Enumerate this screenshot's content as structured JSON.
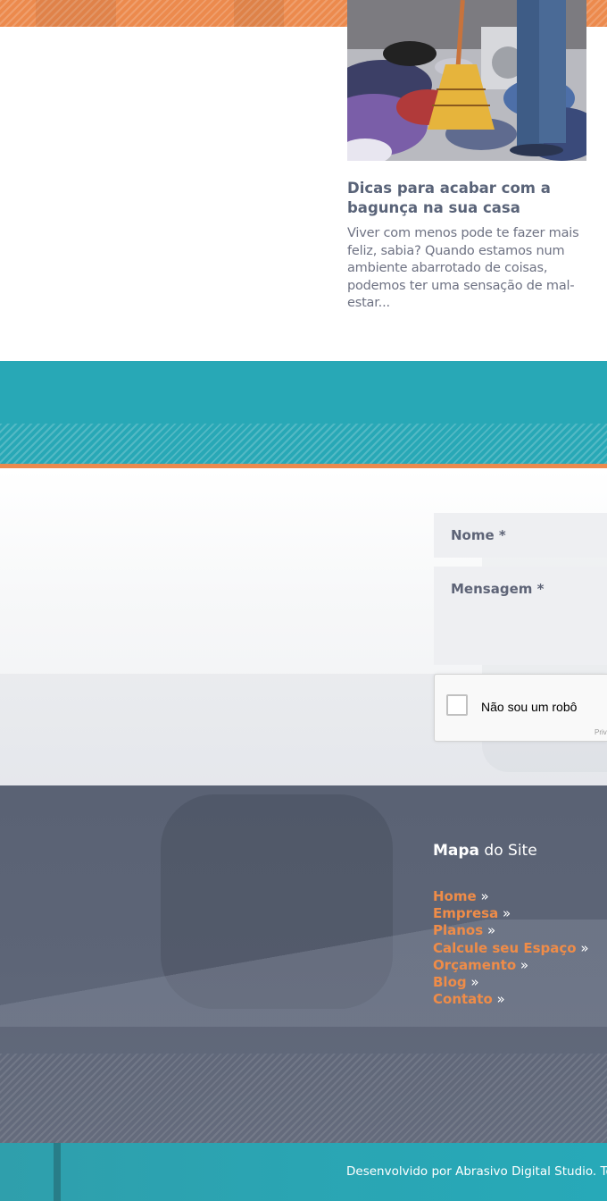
{
  "blog": {
    "post_title": "Dicas para acabar com a bagunça na sua casa",
    "post_excerpt": "Viver com menos pode te fazer mais feliz, sabia? Quando estamos num ambiente abarrotado de coisas, podemos ter uma sensação de mal-estar..."
  },
  "contact_form": {
    "name_placeholder": "Nome *",
    "message_placeholder": "Mensagem *",
    "recaptcha_label": "Não sou um robô",
    "recaptcha_privacy": "Priva"
  },
  "sitemap": {
    "heading_bold": "Mapa",
    "heading_rest": " do Site",
    "separator": "»",
    "items": [
      {
        "label": "Home"
      },
      {
        "label": "Empresa"
      },
      {
        "label": "Planos"
      },
      {
        "label": "Calcule seu Espaço"
      },
      {
        "label": "Orçamento"
      },
      {
        "label": "Blog"
      },
      {
        "label": "Contato"
      }
    ]
  },
  "footer": {
    "credits": "Desenvolvido por Abrasivo Digital Studio. Tod"
  },
  "colors": {
    "accent_orange": "#ec8a4d",
    "teal": "#28a8b6",
    "footer_slate": "#5d6577",
    "link_orange": "#ef8c48",
    "title_slate": "#596378"
  },
  "icons": {
    "post_image": "broom-and-clothes-photo",
    "recaptcha": "checkbox-icon"
  }
}
